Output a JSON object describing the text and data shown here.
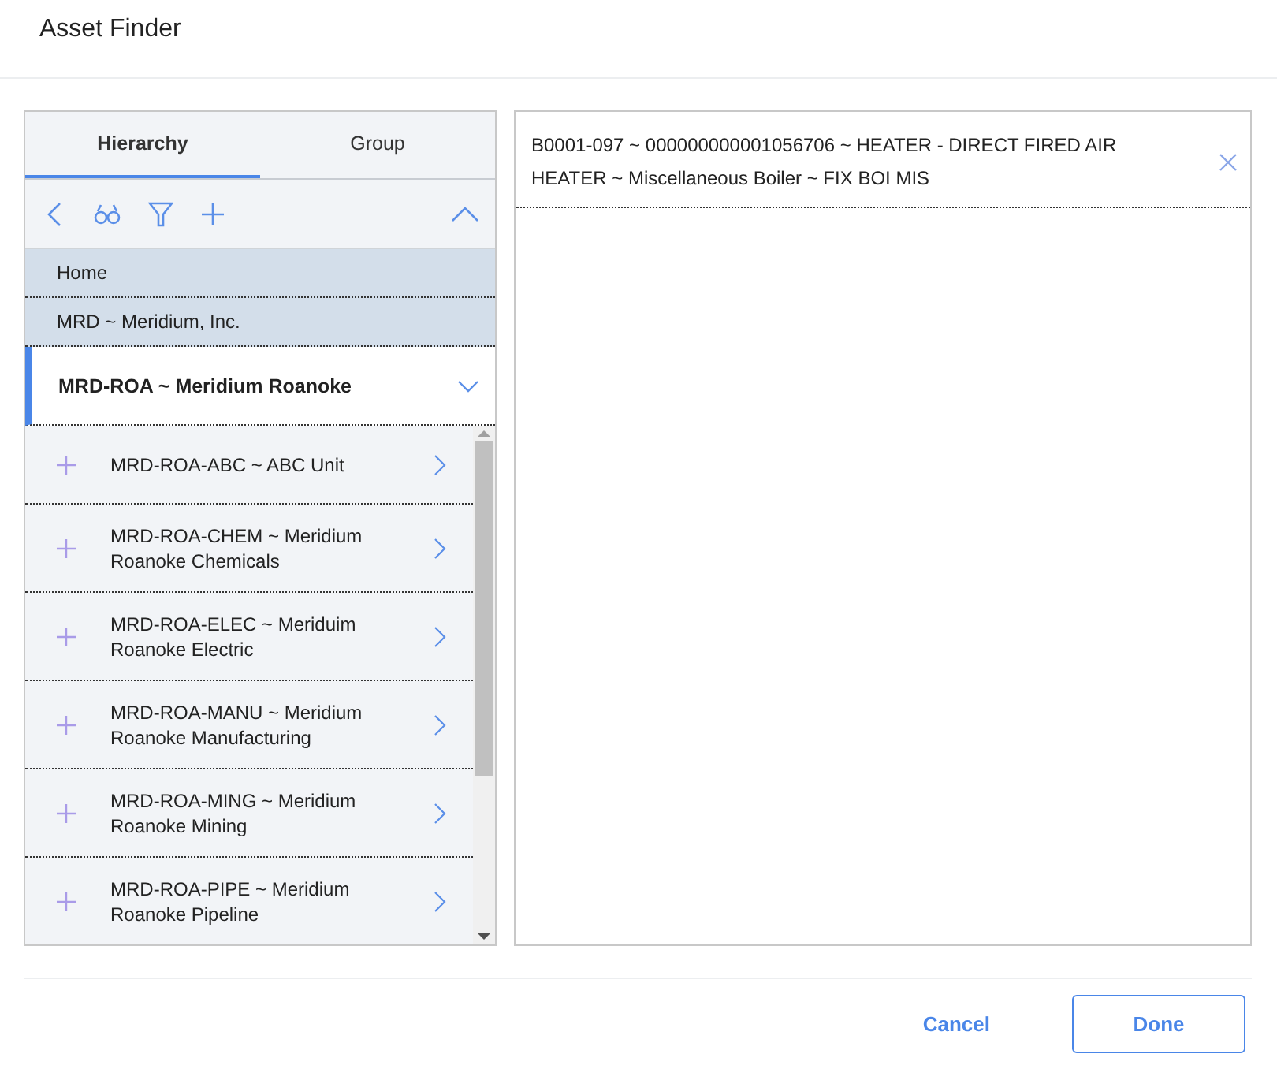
{
  "dialog": {
    "title": "Asset Finder"
  },
  "tabs": [
    {
      "label": "Hierarchy",
      "selected": true
    },
    {
      "label": "Group",
      "selected": false
    }
  ],
  "breadcrumbs": [
    "Home",
    "MRD ~ Meridium, Inc."
  ],
  "current_node": {
    "label": "MRD-ROA ~ Meridium Roanoke",
    "expanded": false
  },
  "children": [
    {
      "label": "MRD-ROA-ABC ~ ABC Unit"
    },
    {
      "label": "MRD-ROA-CHEM ~ Meridium Roanoke Chemicals"
    },
    {
      "label": "MRD-ROA-ELEC ~ Meriduim Roanoke Electric"
    },
    {
      "label": "MRD-ROA-MANU ~ Meridium Roanoke Manufacturing"
    },
    {
      "label": "MRD-ROA-MING ~ Meridium Roanoke Mining"
    },
    {
      "label": "MRD-ROA-PIPE ~ Meridium Roanoke Pipeline"
    }
  ],
  "selected_assets": [
    {
      "label": "B0001-097 ~ 000000000001056706 ~ HEATER - DIRECT FIRED AIR HEATER ~ Miscellaneous Boiler ~ FIX BOI MIS"
    }
  ],
  "buttons": [
    {
      "label": "Cancel",
      "kind": "text"
    },
    {
      "label": "Done",
      "kind": "outline"
    }
  ]
}
